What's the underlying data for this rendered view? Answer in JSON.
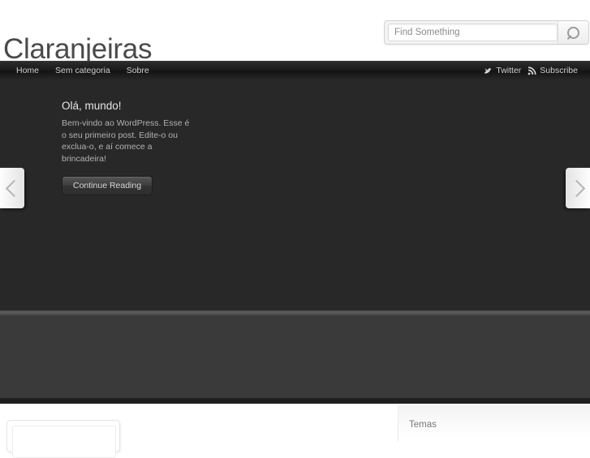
{
  "header": {
    "site_title": "Claranjeiras"
  },
  "search": {
    "placeholder": "Find Something",
    "value": "",
    "button_icon": "search-icon"
  },
  "nav": {
    "items": [
      {
        "label": "Home"
      },
      {
        "label": "Sem categoria"
      },
      {
        "label": "Sobre"
      }
    ],
    "social": [
      {
        "label": "Twitter",
        "icon": "twitter-bird-icon"
      },
      {
        "label": "Subscribe",
        "icon": "rss-icon"
      }
    ]
  },
  "slider": {
    "slide": {
      "title": "Olá, mundo!",
      "text": "Bem-vindo ao WordPress. Esse é o seu primeiro post. Edite-o ou exclua-o, e aí comece a brincadeira!",
      "button_label": "Continue Reading"
    },
    "prev_icon": "chevron-left-icon",
    "next_icon": "chevron-right-icon"
  },
  "sidebar": {
    "title": "Temas"
  },
  "colors": {
    "page_background": "#ffffff",
    "title_text": "#4a4a4a",
    "navbar_dark": "#1b1b1b",
    "slider_background": "#282828",
    "content_band": "#3a3a3a",
    "slide_title_text": "#e6e6e6",
    "slide_body_text": "#b2b2b2"
  }
}
